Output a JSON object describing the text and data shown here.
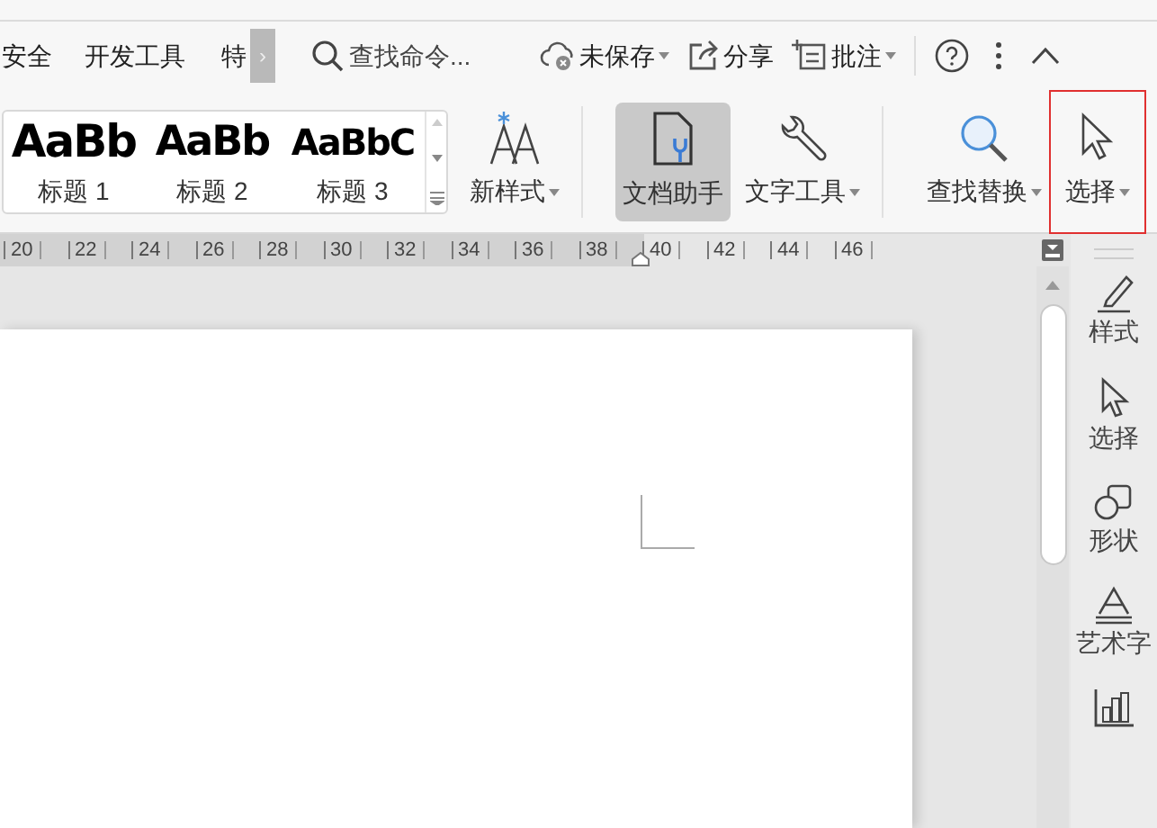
{
  "menu_tabs": [
    {
      "label": "安全"
    },
    {
      "label": "开发工具"
    },
    {
      "label": "特"
    }
  ],
  "more_tabs_button": {
    "label": "›"
  },
  "command_search": {
    "placeholder": "查找命令..."
  },
  "title_actions": [
    {
      "label": "未保存",
      "dropdown": true
    },
    {
      "label": "分享",
      "dropdown": false
    },
    {
      "label": "批注",
      "dropdown": true
    }
  ],
  "style_gallery": [
    {
      "preview": "AaBb",
      "label": "标题 1"
    },
    {
      "preview": "AaBb",
      "label": "标题 2"
    },
    {
      "preview": "AaBbC",
      "label": "标题 3"
    }
  ],
  "ribbon_buttons": [
    {
      "label": "新样式",
      "dropdown": true,
      "selected": false,
      "highlighted": false
    },
    {
      "label": "文档助手",
      "dropdown": false,
      "selected": true,
      "highlighted": false
    },
    {
      "label": "文字工具",
      "dropdown": true,
      "selected": false,
      "highlighted": false
    },
    {
      "label": "查找替换",
      "dropdown": true,
      "selected": false,
      "highlighted": false
    },
    {
      "label": "选择",
      "dropdown": true,
      "selected": false,
      "highlighted": true
    }
  ],
  "ruler": {
    "ticks": [
      "20",
      "22",
      "24",
      "26",
      "28",
      "30",
      "32",
      "34",
      "36",
      "38",
      "40",
      "42",
      "44",
      "46"
    ]
  },
  "side_panel": [
    {
      "label": "样式"
    },
    {
      "label": "选择"
    },
    {
      "label": "形状"
    },
    {
      "label": "艺术字"
    }
  ]
}
